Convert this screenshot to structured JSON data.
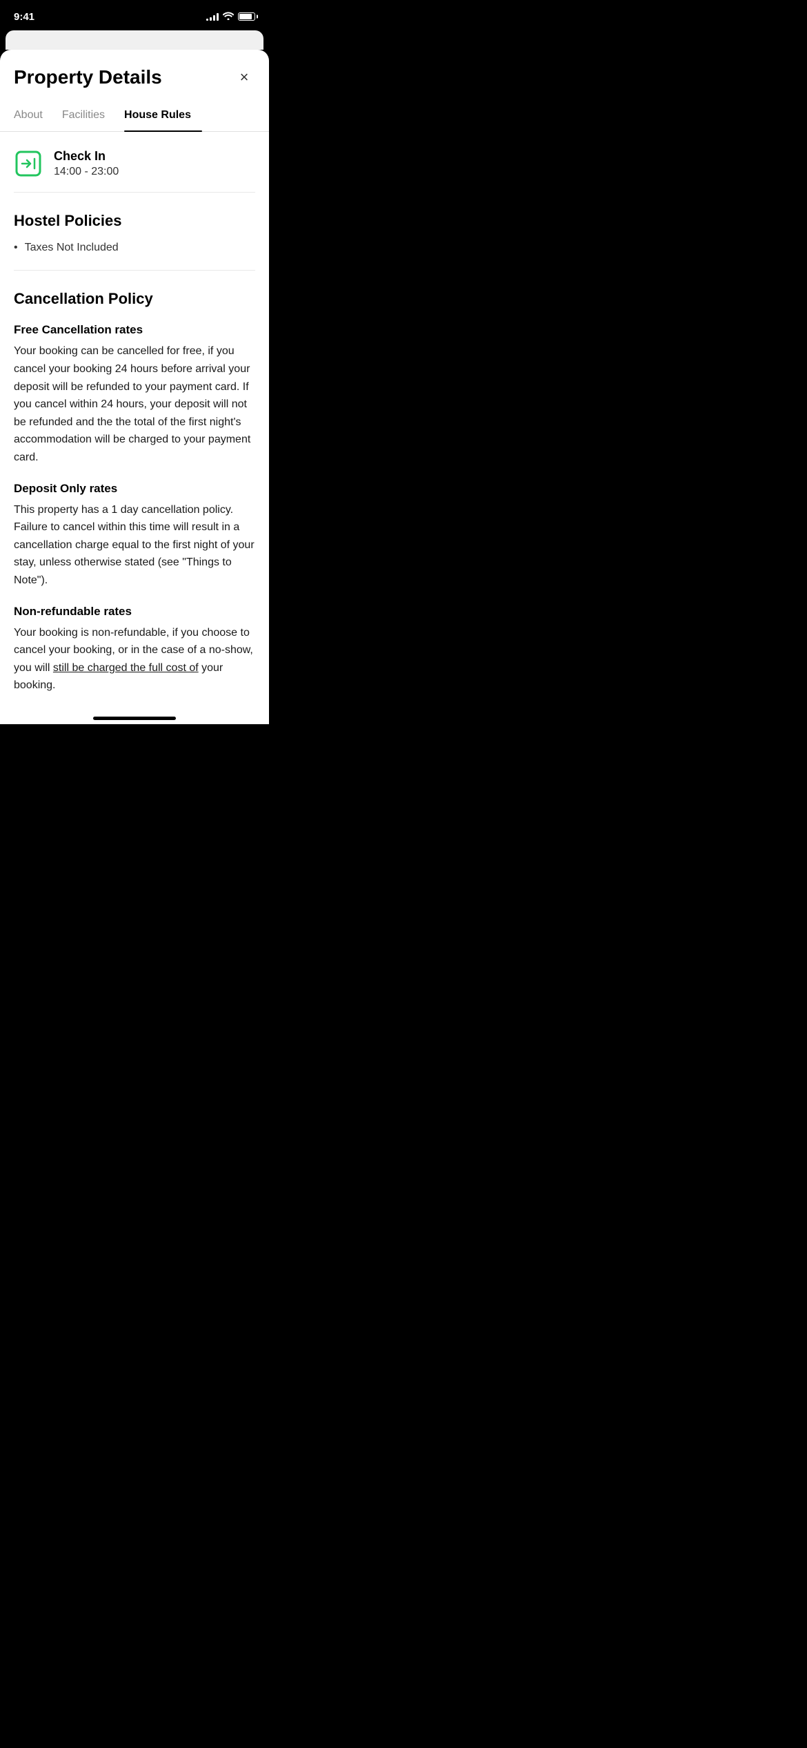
{
  "statusBar": {
    "time": "9:41"
  },
  "modal": {
    "title": "Property Details",
    "closeLabel": "×"
  },
  "tabs": [
    {
      "id": "about",
      "label": "About",
      "active": false
    },
    {
      "id": "facilities",
      "label": "Facilities",
      "active": false
    },
    {
      "id": "house-rules",
      "label": "House Rules",
      "active": true
    }
  ],
  "checkIn": {
    "label": "Check In",
    "time": "14:00 - 23:00"
  },
  "hostelPolicies": {
    "title": "Hostel Policies",
    "items": [
      "Taxes Not Included"
    ]
  },
  "cancellationPolicy": {
    "title": "Cancellation Policy",
    "policies": [
      {
        "heading": "Free Cancellation rates",
        "text": "Your booking can be cancelled for free, if you cancel your booking 24 hours before arrival your deposit will be refunded to your payment card.  If you cancel within 24 hours, your deposit will not be refunded and the the total of the first night's accommodation will be charged to your payment card."
      },
      {
        "heading": "Deposit Only rates",
        "text": "This property has a 1 day cancellation policy. Failure to cancel within this time will result in a cancellation charge equal to the first night of your stay, unless otherwise stated (see \"Things to Note\")."
      },
      {
        "heading": "Non-refundable rates",
        "text": "Your booking is non-refundable, if you choose to cancel your booking, or in the case of a no-show, you will still be charged the full cost of your booking."
      }
    ]
  }
}
